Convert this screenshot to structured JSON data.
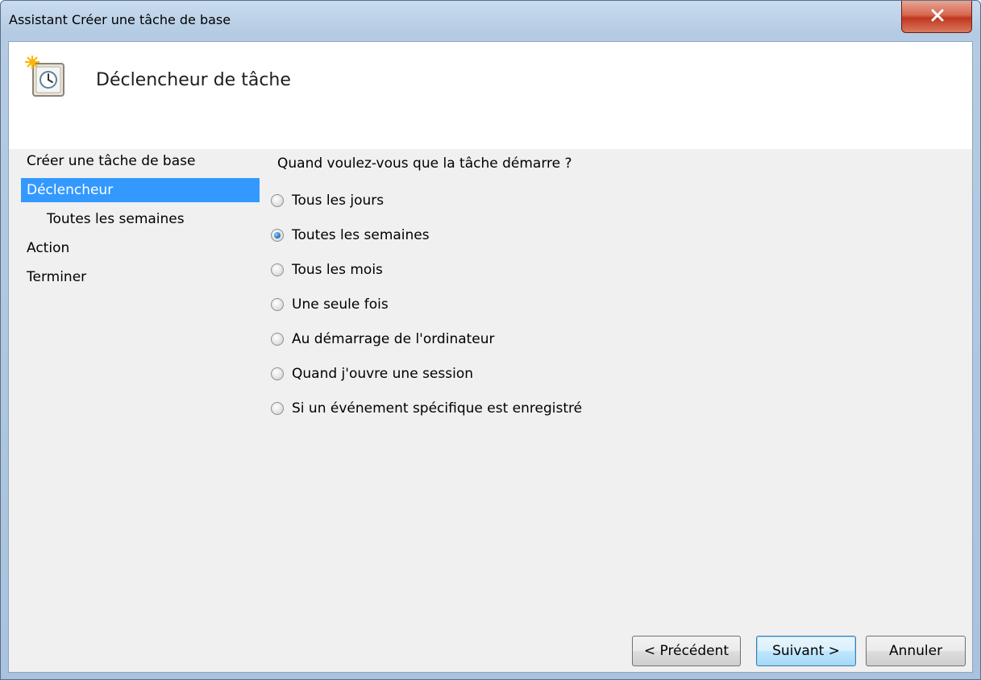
{
  "window": {
    "title": "Assistant Créer une tâche de base"
  },
  "header": {
    "title": "Déclencheur de tâche",
    "icon": "task-clock-icon"
  },
  "nav": {
    "items": [
      {
        "label": "Créer une tâche de base",
        "selected": false
      },
      {
        "label": "Déclencheur",
        "selected": true
      },
      {
        "label": "Toutes les semaines",
        "selected": false,
        "sub": true
      },
      {
        "label": "Action",
        "selected": false
      },
      {
        "label": "Terminer",
        "selected": false
      }
    ]
  },
  "main": {
    "question": "Quand voulez-vous que la tâche démarre ?",
    "options": [
      {
        "label": "Tous les jours",
        "checked": false
      },
      {
        "label": "Toutes les semaines",
        "checked": true
      },
      {
        "label": "Tous les mois",
        "checked": false
      },
      {
        "label": "Une seule fois",
        "checked": false
      },
      {
        "label": "Au démarrage de l'ordinateur",
        "checked": false
      },
      {
        "label": "Quand j'ouvre une session",
        "checked": false
      },
      {
        "label": "Si un événement spécifique est enregistré",
        "checked": false
      }
    ]
  },
  "buttons": {
    "previous": "< Précédent",
    "next": "Suivant >",
    "cancel": "Annuler"
  },
  "colors": {
    "selection": "#3399ff",
    "close_button": "#c0361f"
  }
}
